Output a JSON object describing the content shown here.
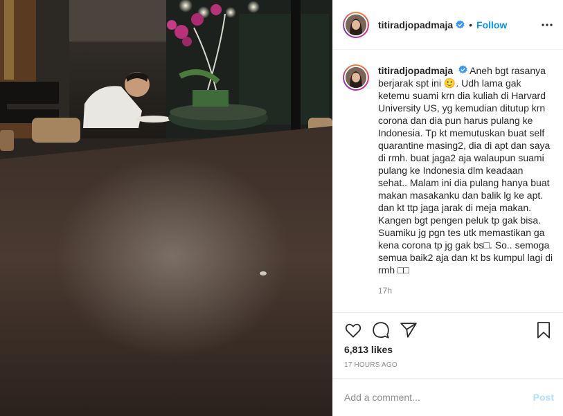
{
  "post": {
    "username": "titiradjopadmaja",
    "follow_label": "Follow",
    "dot": "•",
    "caption": "Aneh bgt rasanya berjarak spt ini 🙂. Udh lama gak ketemu suami krn dia kuliah di Harvard University US, yg kemudian ditutup krn corona dan dia pun harus pulang ke Indonesia. Tp kt memutuskan buat self quarantine masing2, dia di apt dan saya di rmh. buat jaga2 aja walaupun suami pulang ke Indonesia dlm keadaan sehat.. Malam ini dia pulang hanya buat makan masakanku dan balik lg ke apt. dan kt ttp jaga jarak di meja makan. Kangen bgt pengen peluk tp gak bisa. Suamiku jg pgn tes utk memastikan ga kena corona tp jg gak bs□. So.. semoga semua baik2 aja dan kt bs kumpul lagi di rmh □□",
    "caption_time": "17h",
    "likes": "6,813 likes",
    "posted_ago": "17 HOURS AGO",
    "comment_placeholder": "Add a comment...",
    "post_label": "Post"
  },
  "icons": {
    "verified": "verified-badge-icon",
    "more": "more-options-icon",
    "like": "heart-icon",
    "comment": "comment-bubble-icon",
    "share": "paper-plane-icon",
    "save": "bookmark-icon"
  },
  "colors": {
    "link_blue": "#0095f6",
    "muted_text": "#8e8e8e",
    "post_disabled": "#b2dffc",
    "border": "#efefef"
  }
}
